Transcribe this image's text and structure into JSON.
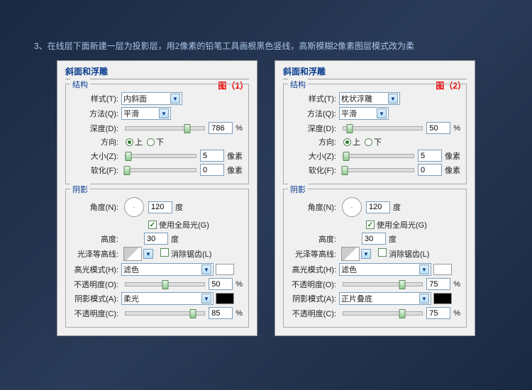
{
  "instr": "3、在线层下面新建一层为投影层，用2像素的铅笔工具画根黑色竖线，高斯模糊2像素图层模式改为柔",
  "common": {
    "title": "斜面和浮雕",
    "grp_struct": "结构",
    "grp_shadow": "阴影",
    "lbl_style": "样式(T):",
    "lbl_method": "方法(Q):",
    "lbl_depth": "深度(D):",
    "lbl_dir": "方向:",
    "lbl_size": "大小(Z):",
    "lbl_soften": "软化(F):",
    "lbl_angle": "角度(N):",
    "lbl_alt": "高度:",
    "lbl_gloss": "光泽等高线:",
    "lbl_hilite": "高光模式(H):",
    "lbl_opac": "不透明度(O):",
    "lbl_shmode": "阴影模式(A):",
    "lbl_opac2": "不透明度(C):",
    "opt_method": "平滑",
    "opt_up": "上",
    "opt_down": "下",
    "global": "使用全局光(G)",
    "anti": "消除锯齿(L)",
    "opt_hilite": "滤色",
    "pct": "%",
    "deg": "度",
    "px": "像素",
    "angle_val": "120",
    "alt_val": "30",
    "size_val": "5",
    "soften_val": "0"
  },
  "p1": {
    "tag": "图（1）",
    "style": "内斜面",
    "depth": "786",
    "opac1": "50",
    "shmode": "柔光",
    "opac2": "85",
    "shcolor": "#000"
  },
  "p2": {
    "tag": "图（2）",
    "style": "枕状浮雕",
    "depth": "50",
    "opac1": "75",
    "shmode": "正片叠底",
    "opac2": "75",
    "shcolor": "#000"
  }
}
